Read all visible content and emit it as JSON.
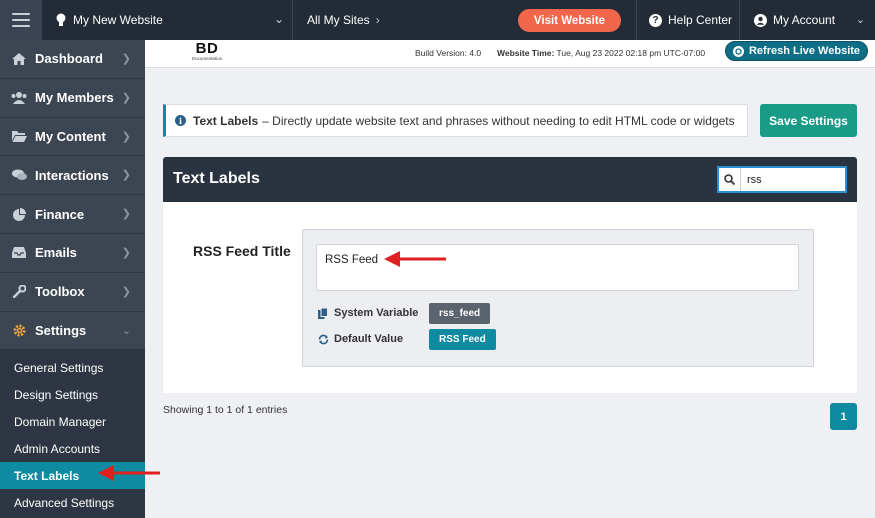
{
  "topbar": {
    "site_name": "My New Website",
    "all_sites": "All My Sites",
    "visit": "Visit Website",
    "help": "Help Center",
    "account": "My Account"
  },
  "sidebar": {
    "items": [
      {
        "label": "Dashboard",
        "icon": "home-icon"
      },
      {
        "label": "My Members",
        "icon": "users-icon"
      },
      {
        "label": "My Content",
        "icon": "folder-icon"
      },
      {
        "label": "Interactions",
        "icon": "comments-icon"
      },
      {
        "label": "Finance",
        "icon": "pie-chart-icon"
      },
      {
        "label": "Emails",
        "icon": "inbox-icon"
      },
      {
        "label": "Toolbox",
        "icon": "wrench-icon"
      },
      {
        "label": "Settings",
        "icon": "gear-icon"
      }
    ],
    "sub_items": [
      {
        "label": "General Settings"
      },
      {
        "label": "Design Settings"
      },
      {
        "label": "Domain Manager"
      },
      {
        "label": "Admin Accounts"
      },
      {
        "label": "Text Labels"
      },
      {
        "label": "Advanced Settings"
      }
    ],
    "active_sub": "Text Labels"
  },
  "subheader": {
    "logo_big": "BD",
    "logo_small": "Documentation",
    "build": "Build Version: 4.0",
    "time_label": "Website Time:",
    "time_value": "Tue, Aug 23 2022 02:18 pm UTC-07:00",
    "refresh": "Refresh Live Website"
  },
  "info": {
    "title": "Text Labels",
    "text": "– Directly update website text and phrases without needing to edit HTML code or widgets"
  },
  "save_label": "Save Settings",
  "panel": {
    "title": "Text Labels",
    "search_value": "rss",
    "field_label": "RSS Feed Title",
    "field_value": "RSS Feed",
    "system_variable_label": "System Variable",
    "system_variable_value": "rss_feed",
    "default_value_label": "Default Value",
    "default_value_value": "RSS Feed"
  },
  "footer": {
    "showing": "Showing 1 to 1 of 1 entries",
    "page": "1"
  },
  "colors": {
    "topbar": "#232b36",
    "sidebar": "#2d3642",
    "accent": "#0e8aa1",
    "visit": "#f2674c",
    "save": "#1a9b88",
    "annotation_arrow": "#e02020"
  }
}
